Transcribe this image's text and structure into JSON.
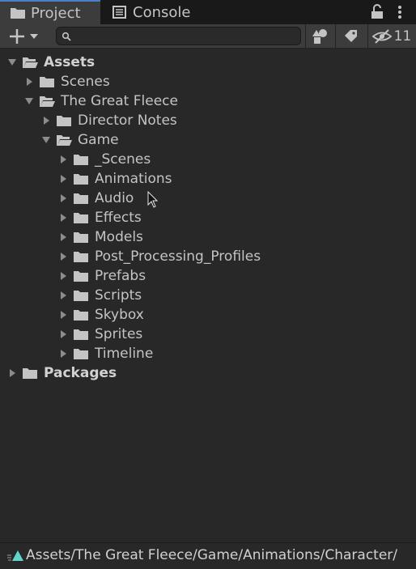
{
  "tabs": [
    {
      "label": "Project",
      "icon": "folder-icon",
      "active": true
    },
    {
      "label": "Console",
      "icon": "console-icon",
      "active": false
    }
  ],
  "toolbar": {
    "search_value": "",
    "hidden_count": "11"
  },
  "tree": [
    {
      "label": "Assets",
      "depth": 0,
      "expanded": true,
      "bold": true,
      "has_children": true
    },
    {
      "label": "Scenes",
      "depth": 1,
      "expanded": false,
      "bold": false,
      "has_children": true
    },
    {
      "label": "The Great Fleece",
      "depth": 1,
      "expanded": true,
      "bold": false,
      "has_children": true
    },
    {
      "label": "Director Notes",
      "depth": 2,
      "expanded": false,
      "bold": false,
      "has_children": true
    },
    {
      "label": "Game",
      "depth": 2,
      "expanded": true,
      "bold": false,
      "has_children": true
    },
    {
      "label": "_Scenes",
      "depth": 3,
      "expanded": false,
      "bold": false,
      "has_children": true
    },
    {
      "label": "Animations",
      "depth": 3,
      "expanded": false,
      "bold": false,
      "has_children": true
    },
    {
      "label": "Audio",
      "depth": 3,
      "expanded": false,
      "bold": false,
      "has_children": true
    },
    {
      "label": "Effects",
      "depth": 3,
      "expanded": false,
      "bold": false,
      "has_children": true
    },
    {
      "label": "Models",
      "depth": 3,
      "expanded": false,
      "bold": false,
      "has_children": true
    },
    {
      "label": "Post_Processing_Profiles",
      "depth": 3,
      "expanded": false,
      "bold": false,
      "has_children": true
    },
    {
      "label": "Prefabs",
      "depth": 3,
      "expanded": false,
      "bold": false,
      "has_children": true
    },
    {
      "label": "Scripts",
      "depth": 3,
      "expanded": false,
      "bold": false,
      "has_children": true
    },
    {
      "label": "Skybox",
      "depth": 3,
      "expanded": false,
      "bold": false,
      "has_children": true
    },
    {
      "label": "Sprites",
      "depth": 3,
      "expanded": false,
      "bold": false,
      "has_children": true
    },
    {
      "label": "Timeline",
      "depth": 3,
      "expanded": false,
      "bold": false,
      "has_children": true
    },
    {
      "label": "Packages",
      "depth": 0,
      "expanded": false,
      "bold": true,
      "has_children": true
    }
  ],
  "status": {
    "path": "Assets/The Great Fleece/Game/Animations/Character/",
    "icon": "animation-asset-icon"
  },
  "colors": {
    "background": "#282828",
    "tab_accent": "#4a7fc7",
    "text": "#c4c4c4",
    "asset_icon": "#5fd6c8"
  }
}
